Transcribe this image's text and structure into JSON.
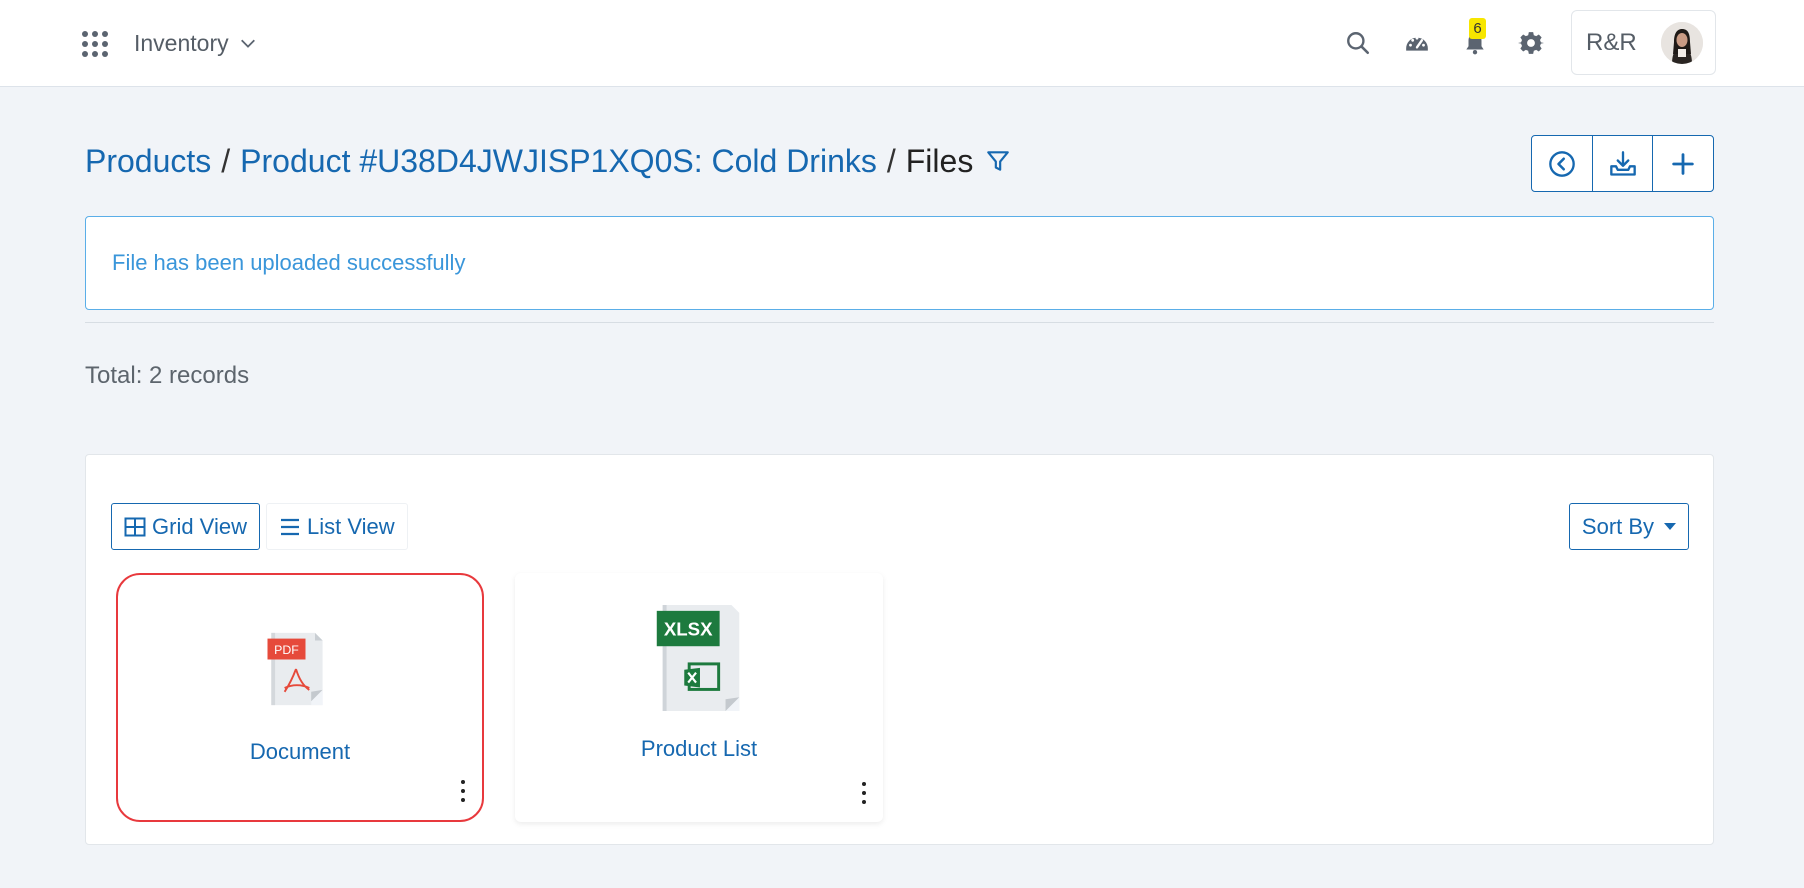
{
  "topbar": {
    "module_name": "Inventory",
    "notification_count": "6",
    "user_initials": "R&R"
  },
  "breadcrumb": {
    "items": [
      "Products",
      "Product #U38D4JWJISP1XQ0S: Cold Drinks"
    ],
    "separator": "/",
    "current": "Files"
  },
  "alert": {
    "message": "File has been uploaded successfully"
  },
  "total": {
    "text": "Total: 2 records"
  },
  "panel": {
    "grid_view_label": "Grid View",
    "list_view_label": "List View",
    "sort_label": "Sort By",
    "files": [
      {
        "name": "Document",
        "type_label": "PDF",
        "selected": true
      },
      {
        "name": "Product List",
        "type_label": "XLSX",
        "selected": false
      }
    ]
  },
  "colors": {
    "accent": "#1668b0",
    "alert_text": "#3a96da",
    "selected_border": "#e8393d",
    "badge": "#f7e600",
    "pdf_red": "#e64a3b",
    "xlsx_green": "#1d7a3e"
  },
  "icons": {
    "apps": "apps-grid-icon",
    "search": "search-icon",
    "dashboard": "dashboard-gauge-icon",
    "notifications": "bell-icon",
    "settings": "gear-icon",
    "filter": "filter-icon",
    "back": "back-circle-icon",
    "download": "download-tray-icon",
    "add": "plus-icon"
  }
}
